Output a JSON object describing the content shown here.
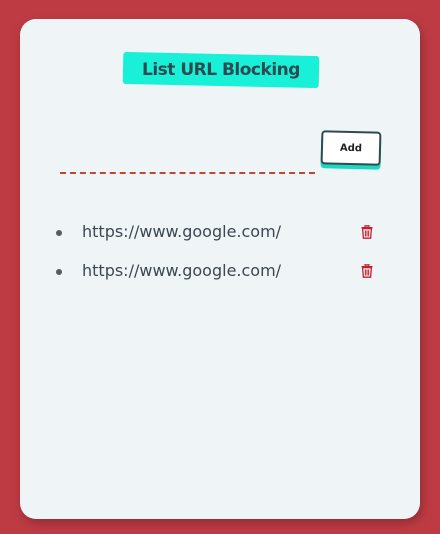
{
  "header": {
    "title": "List URL Blocking"
  },
  "form": {
    "url_value": "",
    "url_placeholder": "",
    "add_label": "Add"
  },
  "blocked_urls": [
    {
      "url": "https://www.google.com/"
    },
    {
      "url": "https://www.google.com/"
    }
  ],
  "icons": {
    "delete": "trash-icon"
  },
  "colors": {
    "background": "#bf3b44",
    "card": "#eff4f7",
    "accent": "#19f0d8",
    "delete": "#c81d2e",
    "input_underline": "#c04733"
  }
}
